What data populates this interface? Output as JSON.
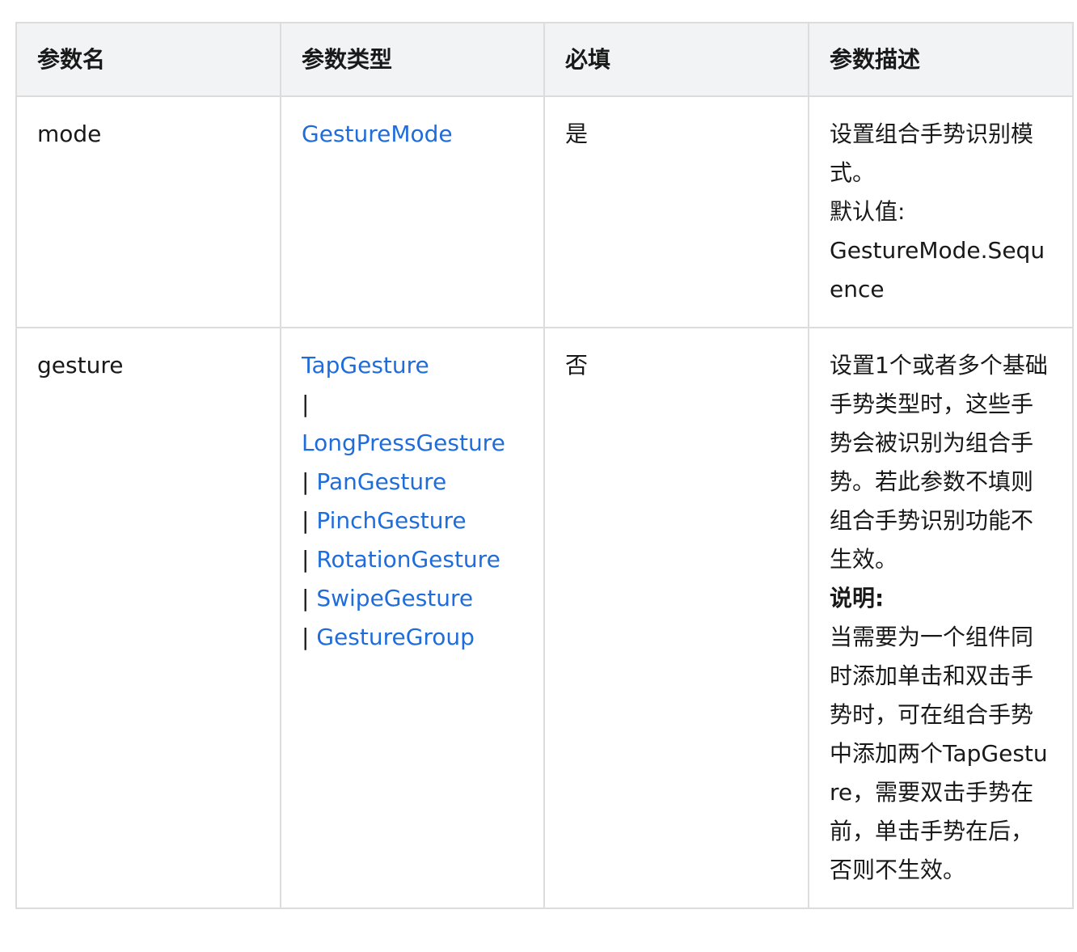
{
  "headers": [
    "参数名",
    "参数类型",
    "必填",
    "参数描述"
  ],
  "rows": [
    {
      "name": "mode",
      "types": [
        {
          "text": "GestureMode",
          "link": true
        }
      ],
      "required": "是",
      "description": {
        "text": "设置组合手势识别模式。",
        "default_label": "默认值:",
        "default_value": "GestureMode.Sequence"
      }
    },
    {
      "name": "gesture",
      "types_first": "TapGesture",
      "types_rest": [
        "LongPressGesture",
        "PanGesture",
        "PinchGesture",
        "RotationGesture",
        "SwipeGesture",
        "GestureGroup"
      ],
      "separator": "|",
      "required": "否",
      "description": {
        "text": "设置1个或者多个基础手势类型时，这些手势会被识别为组合手势。若此参数不填则组合手势识别功能不生效。",
        "note_label": "说明:",
        "note_text": "当需要为一个组件同时添加单击和双击手势时，可在组合手势中添加两个TapGesture，需要双击手势在前，单击手势在后，否则不生效。"
      }
    }
  ]
}
